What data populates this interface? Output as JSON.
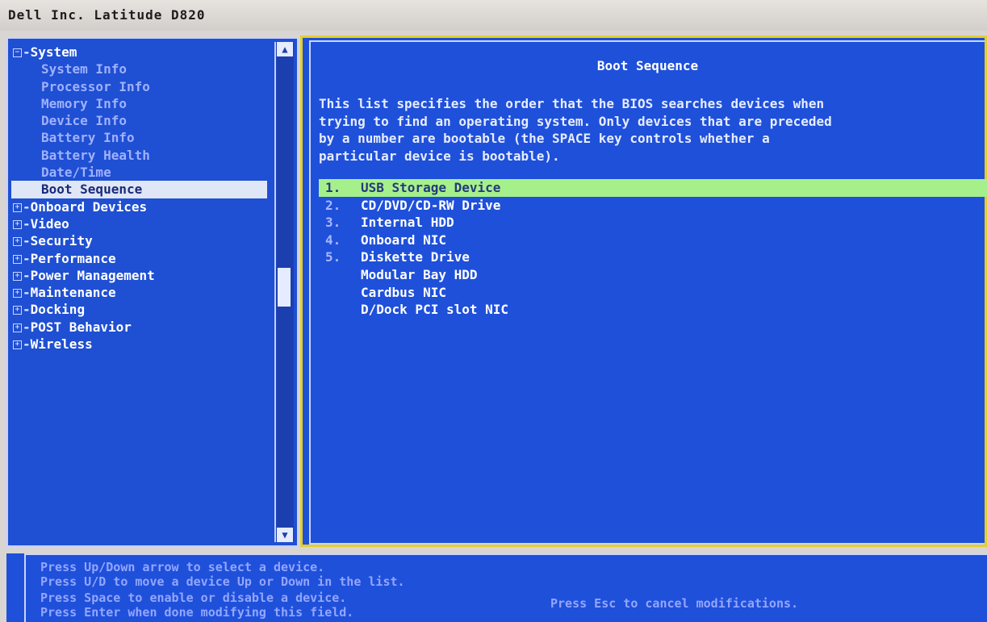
{
  "window": {
    "title": "Dell Inc. Latitude D820"
  },
  "nav": {
    "items": [
      {
        "label": "System",
        "type": "category",
        "expanded": true
      },
      {
        "label": "System Info",
        "type": "sub"
      },
      {
        "label": "Processor Info",
        "type": "sub"
      },
      {
        "label": "Memory Info",
        "type": "sub"
      },
      {
        "label": "Device Info",
        "type": "sub"
      },
      {
        "label": "Battery Info",
        "type": "sub"
      },
      {
        "label": "Battery Health",
        "type": "sub"
      },
      {
        "label": "Date/Time",
        "type": "sub"
      },
      {
        "label": "Boot Sequence",
        "type": "sub",
        "selected": true
      },
      {
        "label": "Onboard Devices",
        "type": "category"
      },
      {
        "label": "Video",
        "type": "category"
      },
      {
        "label": "Security",
        "type": "category"
      },
      {
        "label": "Performance",
        "type": "category"
      },
      {
        "label": "Power Management",
        "type": "category"
      },
      {
        "label": "Maintenance",
        "type": "category"
      },
      {
        "label": "Docking",
        "type": "category"
      },
      {
        "label": "POST Behavior",
        "type": "category"
      },
      {
        "label": "Wireless",
        "type": "category"
      }
    ],
    "scroll_up_icon": "scroll-up-arrow",
    "scroll_down_icon": "scroll-down-arrow"
  },
  "content": {
    "title": "Boot Sequence",
    "description_lines": [
      "This list specifies the order that the BIOS searches devices when",
      "trying to find an operating system. Only devices that are preceded",
      "by a number are bootable (the SPACE key controls whether a",
      "particular device is bootable)."
    ],
    "boot_devices": [
      {
        "number": "1.",
        "name": "USB Storage Device",
        "selected": true
      },
      {
        "number": "2.",
        "name": "CD/DVD/CD-RW Drive"
      },
      {
        "number": "3.",
        "name": "Internal HDD"
      },
      {
        "number": "4.",
        "name": "Onboard NIC"
      },
      {
        "number": "5.",
        "name": "Diskette Drive"
      },
      {
        "number": "",
        "name": "Modular Bay HDD"
      },
      {
        "number": "",
        "name": "Cardbus NIC"
      },
      {
        "number": "",
        "name": "D/Dock PCI slot NIC"
      }
    ]
  },
  "help": {
    "lines": [
      "Press Up/Down arrow to select a device.",
      "Press U/D to move a device Up or Down in the list.",
      "Press Space to enable or disable a device.",
      "Press Enter when done modifying this field."
    ],
    "right_text": "Press Esc to cancel modifications."
  },
  "colors": {
    "background_blue": "#1f50da",
    "selection_green": "#a6f08c",
    "content_border_yellow": "#e4cf2a",
    "nav_selection": "#dfe6f5"
  }
}
